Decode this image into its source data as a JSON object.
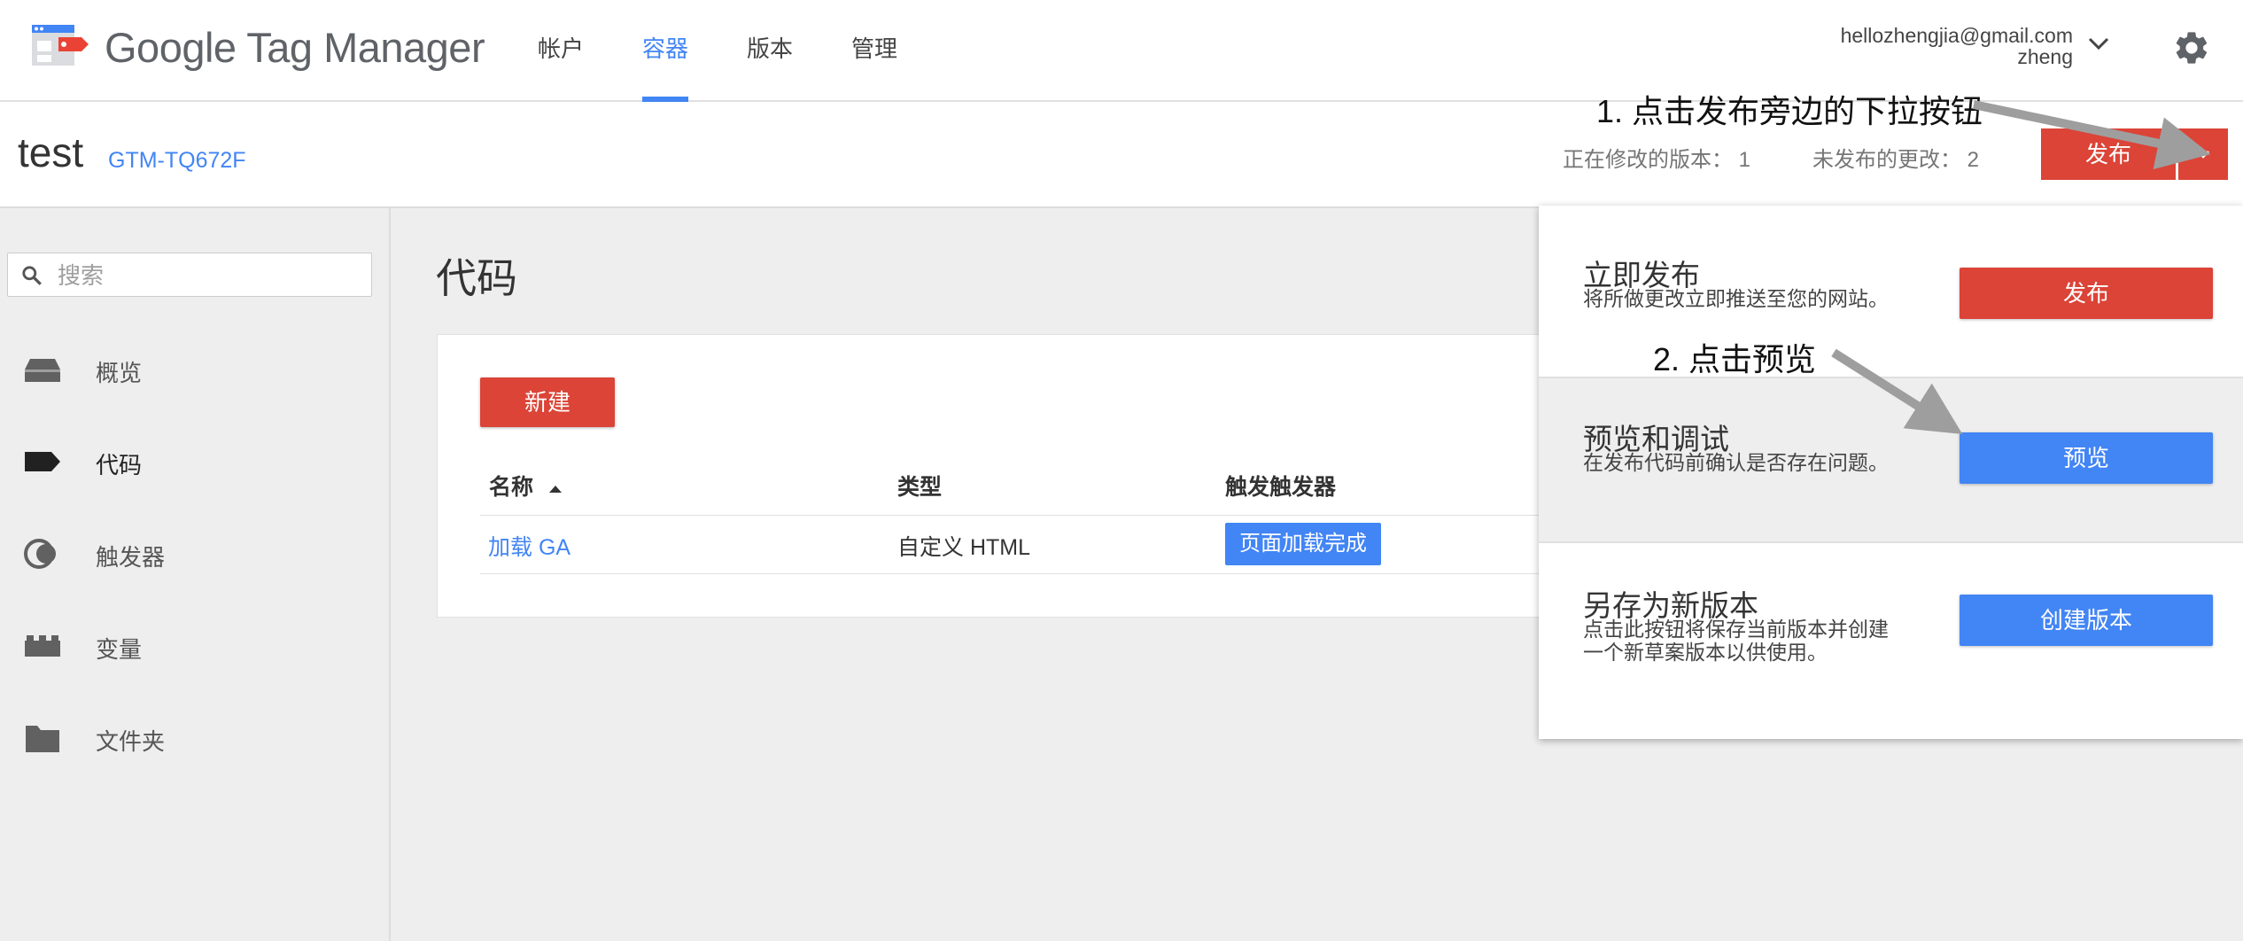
{
  "app": {
    "name": "Google Tag Manager",
    "colors": {
      "accent": "#4285f4",
      "publish": "#db4437",
      "logo_blue": "#4285f4",
      "logo_red": "#ea4335"
    }
  },
  "header": {
    "tabs": [
      {
        "label": "帐户",
        "active": false
      },
      {
        "label": "容器",
        "active": true
      },
      {
        "label": "版本",
        "active": false
      },
      {
        "label": "管理",
        "active": false
      }
    ],
    "account": {
      "email": "hellozhengjia@gmail.com",
      "name": "zheng"
    },
    "icons": {
      "settings": "gear-icon",
      "account_menu": "chevron-down-icon"
    }
  },
  "container": {
    "name": "test",
    "id": "GTM-TQ672F",
    "editing_version_label": "正在修改的版本：",
    "editing_version_value": "1",
    "unpublished_changes_label": "未发布的更改：",
    "unpublished_changes_value": "2",
    "publish_label": "发布"
  },
  "sidebar": {
    "search_placeholder": "搜索",
    "items": [
      {
        "label": "概览",
        "icon": "overview-icon",
        "active": false
      },
      {
        "label": "代码",
        "icon": "tag-icon",
        "active": true
      },
      {
        "label": "触发器",
        "icon": "trigger-icon",
        "active": false
      },
      {
        "label": "变量",
        "icon": "variable-icon",
        "active": false
      },
      {
        "label": "文件夹",
        "icon": "folder-icon",
        "active": false
      }
    ]
  },
  "main": {
    "title": "代码",
    "new_button": "新建",
    "columns": [
      "名称",
      "类型",
      "触发触发器"
    ],
    "rows": [
      {
        "name": "加载 GA",
        "type": "自定义 HTML",
        "trigger": "页面加载完成"
      }
    ]
  },
  "publish_menu": {
    "options": [
      {
        "title": "立即发布",
        "desc": "将所做更改立即推送至您的网站。",
        "button": "发布",
        "color": "#db4437"
      },
      {
        "title": "预览和调试",
        "desc": "在发布代码前确认是否存在问题。",
        "button": "预览",
        "color": "#4285f4"
      },
      {
        "title": "另存为新版本",
        "desc": "点击此按钮将保存当前版本并创建一个新草案版本以供使用。",
        "button": "创建版本",
        "color": "#4285f4"
      }
    ]
  },
  "annotations": {
    "step1": "1. 点击发布旁边的下拉按钮",
    "step2": "2. 点击预览"
  }
}
